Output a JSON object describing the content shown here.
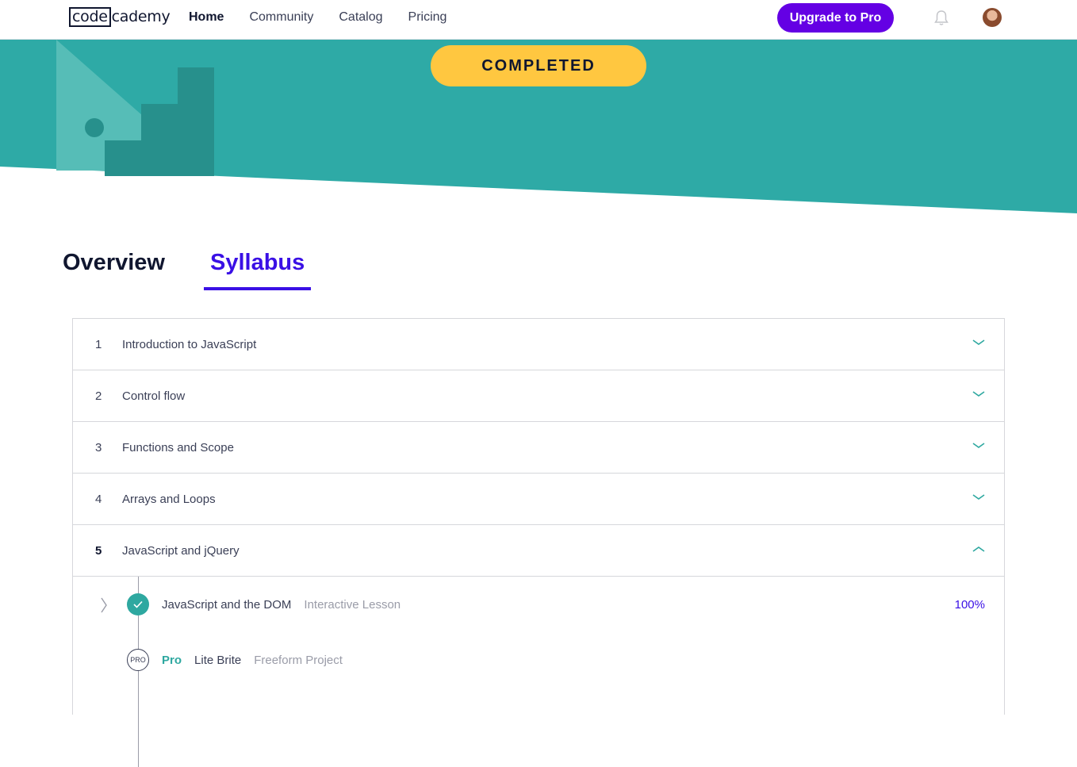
{
  "header": {
    "logo_part1": "code",
    "logo_part2": "cademy",
    "nav": [
      "Home",
      "Community",
      "Catalog",
      "Pricing"
    ],
    "upgrade_label": "Upgrade to Pro"
  },
  "hero": {
    "status_label": "COMPLETED"
  },
  "tabs": [
    "Overview",
    "Syllabus"
  ],
  "syllabus": {
    "modules": [
      {
        "number": "1",
        "title": "Introduction to JavaScript"
      },
      {
        "number": "2",
        "title": "Control flow"
      },
      {
        "number": "3",
        "title": "Functions and Scope"
      },
      {
        "number": "4",
        "title": "Arrays and Loops"
      },
      {
        "number": "5",
        "title": "JavaScript and jQuery"
      }
    ],
    "items": [
      {
        "title": "JavaScript and the DOM",
        "kind": "Interactive Lesson",
        "progress": "100%"
      },
      {
        "badge": "PRO",
        "tag": "Pro",
        "title": "Lite Brite",
        "kind": "Freeform Project"
      }
    ]
  },
  "colors": {
    "hero_teal": "#2eaaa6",
    "accent_purple": "#3a10e5",
    "upgrade_purple": "#6400e4",
    "completed_yellow": "#ffc740",
    "chevron_teal": "#2ea8a0"
  }
}
